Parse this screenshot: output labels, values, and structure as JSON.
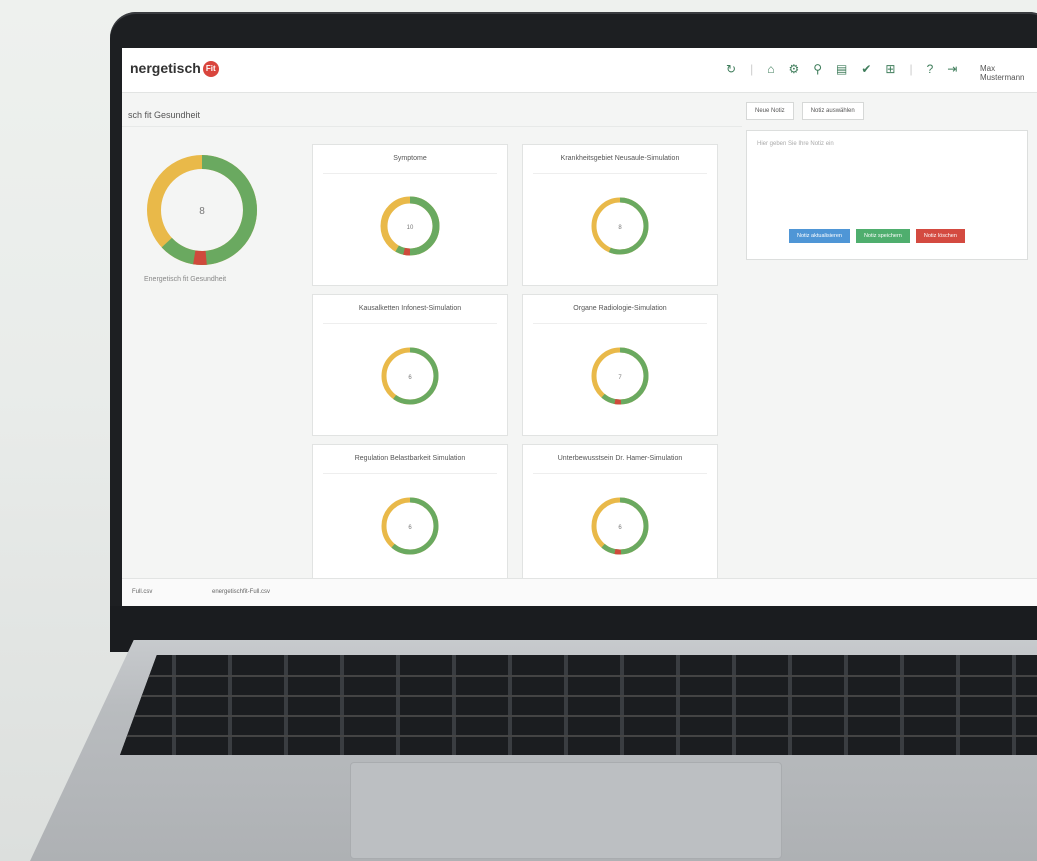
{
  "header": {
    "brand": "nergetisch",
    "badge": "Fit",
    "icons": [
      "refresh-icon",
      "home-icon",
      "settings-icon",
      "pin-icon",
      "document-icon",
      "check-icon",
      "cart-icon",
      "help-icon",
      "logout-icon"
    ],
    "user": "Max Mustermann"
  },
  "panel": {
    "title": "sch fit Gesundheit"
  },
  "big_donut": {
    "value": "8",
    "label": "Energetisch fit Gesundheit"
  },
  "cards": [
    {
      "title": "Symptome",
      "value": "10"
    },
    {
      "title": "Krankheitsgebiet Neusaule-Simulation",
      "value": "8"
    },
    {
      "title": "Kausalketten Infonest-Simulation",
      "value": "6"
    },
    {
      "title": "Organe Radiologie-Simulation",
      "value": "7"
    },
    {
      "title": "Regulation Belastbarkeit Simulation",
      "value": "6"
    },
    {
      "title": "Unterbewusstsein Dr. Hamer-Simulation",
      "value": "6"
    }
  ],
  "right_panel": {
    "tab1": "Neue Notiz",
    "tab2": "Notiz auswählen",
    "placeholder": "Hier geben Sie Ihre Notiz ein",
    "btn_blue": "Notiz aktualisieren",
    "btn_green": "Notiz speichern",
    "btn_red": "Notiz löschen"
  },
  "downloads": {
    "item1": "Full.csv",
    "item2": "energetischfit-Full.csv"
  },
  "colors": {
    "green": "#6aa960",
    "yellow": "#e9b949",
    "red": "#cf4a3c"
  },
  "donut_shares": {
    "big": [
      0.62,
      0.3,
      0.05
    ],
    "small": [
      0.58,
      0.35,
      0.04
    ]
  }
}
